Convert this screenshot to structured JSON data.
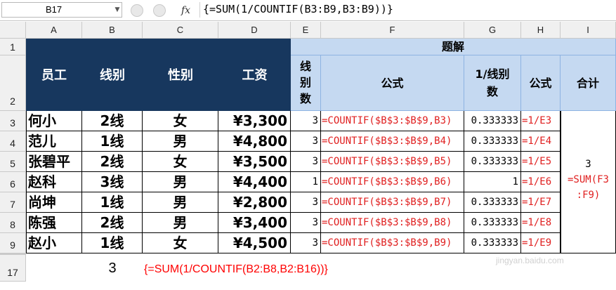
{
  "formula_bar": {
    "name_box": "B17",
    "fx_label": "fx",
    "formula": "{=SUM(1/COUNTIF(B3:B9,B3:B9))}"
  },
  "columns": [
    "A",
    "B",
    "C",
    "D",
    "E",
    "F",
    "G",
    "H",
    "I"
  ],
  "rows": [
    "1",
    "2",
    "3",
    "4",
    "5",
    "6",
    "7",
    "8",
    "9",
    "17"
  ],
  "headers": {
    "employee": "员工",
    "line": "线别",
    "gender": "性别",
    "salary": "工资",
    "solution": "题解",
    "line_count": [
      "线",
      "别",
      "数"
    ],
    "formula": "公式",
    "reciprocal": [
      "1/线别",
      "数"
    ],
    "formula2": "公式",
    "total": "合计"
  },
  "data_rows": [
    {
      "name": "何小",
      "line": "2线",
      "gender": "女",
      "salary": "¥3,300",
      "count": "3",
      "countif": "=COUNTIF($B$3:$B$9,B3)",
      "recip": "0.333333",
      "ref": "=1/E3"
    },
    {
      "name": "范儿",
      "line": "1线",
      "gender": "男",
      "salary": "¥4,800",
      "count": "3",
      "countif": "=COUNTIF($B$3:$B$9,B4)",
      "recip": "0.333333",
      "ref": "=1/E4"
    },
    {
      "name": "张碧平",
      "line": "2线",
      "gender": "女",
      "salary": "¥3,500",
      "count": "3",
      "countif": "=COUNTIF($B$3:$B$9,B5)",
      "recip": "0.333333",
      "ref": "=1/E5"
    },
    {
      "name": "赵科",
      "line": "3线",
      "gender": "男",
      "salary": "¥4,400",
      "count": "1",
      "countif": "=COUNTIF($B$3:$B$9,B6)",
      "recip": "1",
      "ref": "=1/E6"
    },
    {
      "name": "尚坤",
      "line": "1线",
      "gender": "男",
      "salary": "¥2,800",
      "count": "3",
      "countif": "=COUNTIF($B$3:$B$9,B7)",
      "recip": "0.333333",
      "ref": "=1/E7"
    },
    {
      "name": "陈强",
      "line": "2线",
      "gender": "男",
      "salary": "¥3,400",
      "count": "3",
      "countif": "=COUNTIF($B$3:$B$9,B8)",
      "recip": "0.333333",
      "ref": "=1/E8"
    },
    {
      "name": "赵小",
      "line": "1线",
      "gender": "女",
      "salary": "¥4,500",
      "count": "3",
      "countif": "=COUNTIF($B$3:$B$9,B9)",
      "recip": "0.333333",
      "ref": "=1/E9"
    }
  ],
  "total": {
    "value": "3",
    "formula_line1": "=SUM(F3",
    "formula_line2": ":F9)"
  },
  "row17": {
    "value": "3",
    "formula": "{=SUM(1/COUNTIF(B2:B8,B2:B16))}"
  },
  "watermark": "jingyan.baidu.com"
}
